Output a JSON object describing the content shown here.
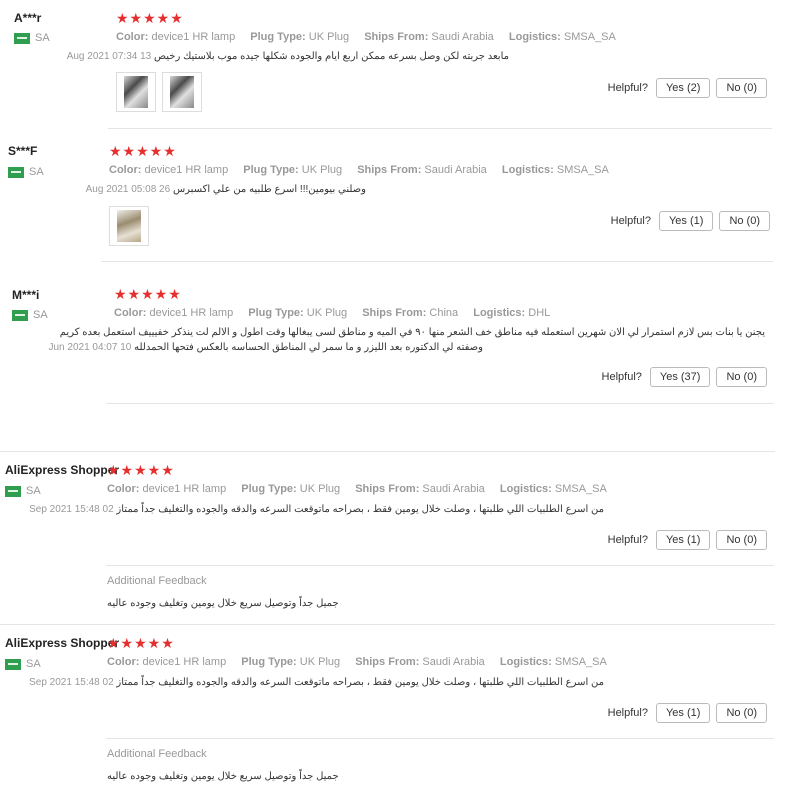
{
  "labels": {
    "color": "Color:",
    "plug": "Plug Type:",
    "ships": "Ships From:",
    "logistics": "Logistics:",
    "helpful": "Helpful?",
    "additional_feedback": "Additional Feedback"
  },
  "reviews": [
    {
      "user": "A***r",
      "country": "SA",
      "stars": "★★★★★",
      "color": "device1 HR lamp",
      "plug": "UK Plug",
      "ships": "Saudi Arabia",
      "logistics": "SMSA_SA",
      "text": "مابعد جربته لكن وصل بسرعه ممكن اربع ايام والجوده شكلها جيده موب بلاستيك رخيص",
      "date": "13 Aug 2021 07:34",
      "yes": "Yes (2)",
      "no": "No (0)"
    },
    {
      "user": "S***F",
      "country": "SA",
      "stars": "★★★★★",
      "color": "device1 HR lamp",
      "plug": "UK Plug",
      "ships": "Saudi Arabia",
      "logistics": "SMSA_SA",
      "text": "وصلني بيومين!!! اسرع طلبيه من علي اكسبرس",
      "date": "26 Aug 2021 05:08",
      "yes": "Yes (1)",
      "no": "No (0)"
    },
    {
      "user": "M***i",
      "country": "SA",
      "stars": "★★★★★",
      "color": "device1 HR lamp",
      "plug": "UK Plug",
      "ships": "China",
      "logistics": "DHL",
      "text": "يجنن يا بنات بس لازم استمرار لي الان شهرين استعمله فيه مناطق خف الشعر منها ٩٠ في الميه و مناطق لسى يبغالها وقت اطول و الالم لت ينذكر خفيييف استعمل بعده كريم",
      "text2": "وصفته لي الدكتوره بعد الليزر و ما سمر لي المناطق الحساسه بالعكس فتحها الحمدلله",
      "date": "10 Jun 2021 04:07",
      "yes": "Yes (37)",
      "no": "No (0)"
    },
    {
      "user": "AliExpress Shopper",
      "country": "SA",
      "stars": "★★★★★",
      "color": "device1 HR lamp",
      "plug": "UK Plug",
      "ships": "Saudi Arabia",
      "logistics": "SMSA_SA",
      "text": "من اسرع الطلبيات اللي طلبتها ، وصلت خلال يومين فقط ، بصراحه ماتوقعت السرعه والدقه والجوده والتغليف جداً ممتاز",
      "date": "02 Sep 2021 15:48",
      "yes": "Yes (1)",
      "no": "No (0)",
      "additional": "جميل جداً وتوصيل سريع خلال يومين وتغليف وجوده عاليه"
    },
    {
      "user": "AliExpress Shopper",
      "country": "SA",
      "stars": "★★★★★",
      "color": "device1 HR lamp",
      "plug": "UK Plug",
      "ships": "Saudi Arabia",
      "logistics": "SMSA_SA",
      "text": "من اسرع الطلبيات اللي طلبتها ، وصلت خلال يومين فقط ، بصراحه ماتوقعت السرعه والدقه والجوده والتغليف جداً ممتاز",
      "date": "02 Sep 2021 15:48",
      "yes": "Yes (1)",
      "no": "No (0)",
      "additional": "جميل جداً وتوصيل سريع خلال يومين وتغليف وجوده عاليه"
    }
  ],
  "colors": {
    "star": "#e62e2e",
    "flag": "#2f9e4f"
  },
  "icons": {
    "flag": "saudi-flag-icon",
    "photo": "review-photo-thumbnail"
  }
}
